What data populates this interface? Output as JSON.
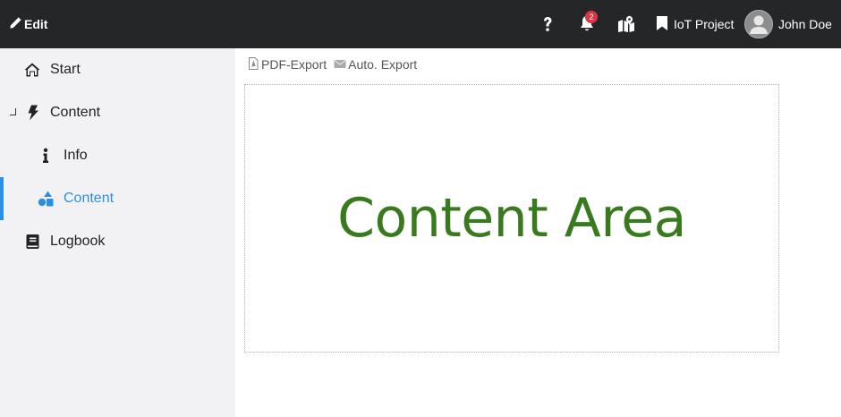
{
  "header": {
    "edit_label": "Edit",
    "notification_count": "2",
    "project_label": "IoT Project",
    "user_name": "John Doe"
  },
  "sidebar": {
    "items": [
      {
        "label": "Start",
        "icon": "home-icon"
      },
      {
        "label": "Content",
        "icon": "bolt-icon",
        "expanded": true
      },
      {
        "label": "Info",
        "icon": "info-icon"
      },
      {
        "label": "Content",
        "icon": "shapes-icon",
        "active": true
      },
      {
        "label": "Logbook",
        "icon": "book-icon"
      }
    ]
  },
  "toolbar": {
    "pdf_export_label": "PDF-Export",
    "auto_export_label": "Auto. Export"
  },
  "main": {
    "content_title": "Content Area"
  },
  "colors": {
    "topbar": "#242628",
    "sidebar": "#f2f2f4",
    "accent": "#2e8fe0",
    "badge": "#dc3545",
    "content_title": "#3a7a1f"
  }
}
